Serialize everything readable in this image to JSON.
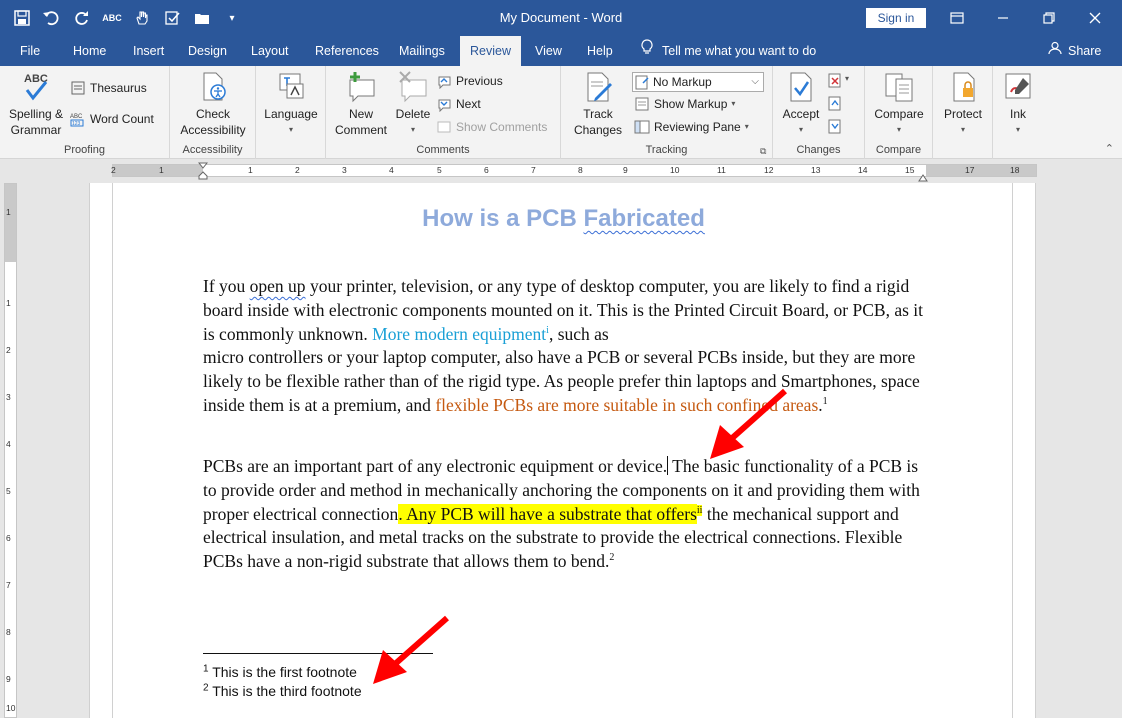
{
  "window": {
    "title": "My Document  -  Word",
    "sign_in": "Sign in"
  },
  "tabs": [
    "File",
    "Home",
    "Insert",
    "Design",
    "Layout",
    "References",
    "Mailings",
    "Review",
    "View",
    "Help"
  ],
  "active_tab": "Review",
  "tell_me": "Tell me what you want to do",
  "share": "Share",
  "ribbon": {
    "proofing": {
      "label": "Proofing",
      "spelling": "Spelling &\nGrammar",
      "thesaurus": "Thesaurus",
      "word_count": "Word Count"
    },
    "accessibility": {
      "label": "Accessibility",
      "check": "Check\nAccessibility"
    },
    "language": {
      "label": "Language"
    },
    "comments": {
      "label": "Comments",
      "new": "New\nComment",
      "delete": "Delete",
      "previous": "Previous",
      "next": "Next",
      "show": "Show Comments"
    },
    "tracking": {
      "label": "Tracking",
      "track": "Track\nChanges",
      "markup_value": "No Markup",
      "show_markup": "Show Markup",
      "reviewing_pane": "Reviewing Pane"
    },
    "changes": {
      "label": "Changes",
      "accept": "Accept"
    },
    "compare": {
      "label": "Compare",
      "compare": "Compare"
    },
    "protect": {
      "protect": "Protect"
    },
    "ink": {
      "ink": "Ink"
    }
  },
  "ruler": {
    "h_numbers": [
      "2",
      "1",
      "1",
      "2",
      "3",
      "4",
      "5",
      "6",
      "7",
      "8",
      "9",
      "10",
      "11",
      "12",
      "13",
      "14",
      "15",
      "17",
      "18"
    ],
    "v_numbers": [
      "1",
      "1",
      "2",
      "3",
      "4",
      "5",
      "6",
      "7",
      "8",
      "9",
      "10"
    ]
  },
  "document": {
    "title_pre": "How is a PCB ",
    "title_squiggle": "Fabricated",
    "p1": {
      "a": "If you ",
      "b": "open up",
      "c": " your printer, television, or any type of desktop computer, you are likely to find a rigid board inside with electronic components mounted on it. This is the Printed Circuit Board, or PCB, as it is commonly unknown. ",
      "teal": "More modern equipment",
      "sup_i": "i",
      "d": ", such as",
      "e": "micro controllers or your laptop computer, also have a PCB or several PCBs inside, but they are more likely to be flexible rather than of the rigid type. As people prefer thin laptops and Smartphones, space inside them is at a premium, and ",
      "orange": "flexible PCBs are more suitable in such confined areas",
      "f": ".",
      "sup_1": "1"
    },
    "p2": {
      "a": "PCBs are an important part of any electronic equipment or device.",
      "b": " The basic functionality of a PCB is to provide order and method in mechanically anchoring the components on it and providing them with proper electrical connection",
      "hl": ". Any PCB will have a substrate that offers",
      "sup_ii": "ii",
      "c": " the mechanical support and electrical insulation, and metal tracks on the substrate to provide the electrical connections. Flexible PCBs have a non-rigid substrate that allows them to bend.",
      "sup_2": "2"
    },
    "footnotes": [
      {
        "num": "1",
        "text": " This is the first footnote"
      },
      {
        "num": "2",
        "text": " This is the third footnote"
      }
    ]
  },
  "colors": {
    "brand": "#2b579a",
    "title": "#8eaadb",
    "teal_text": "#1aa0d6",
    "orange_text": "#c55a11",
    "highlight": "#ffff00",
    "arrow": "#ff0000"
  }
}
